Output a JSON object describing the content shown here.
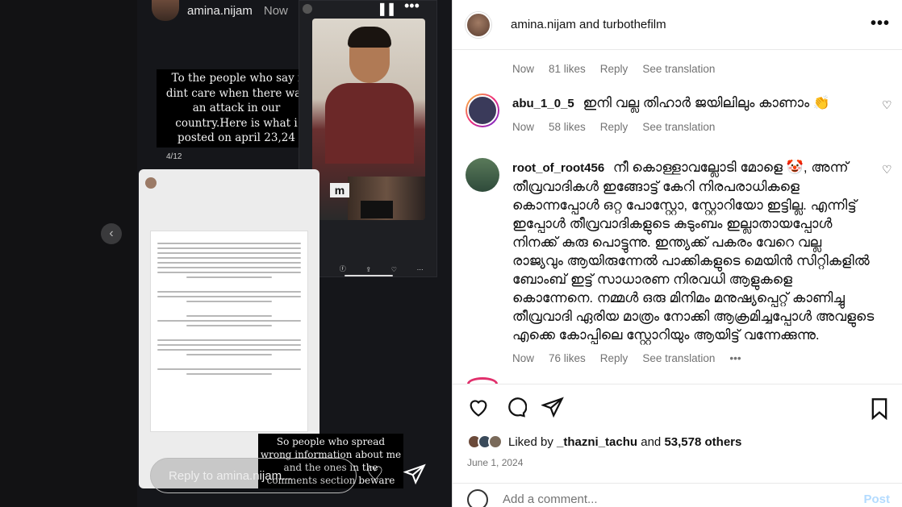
{
  "story": {
    "username": "amina.nijam",
    "time": "Now",
    "overlay_text_1": "To the people who say i dint care when there was an attack in our country.Here is what i posted on april 23,24",
    "count": "4/12",
    "overlay_text_2": "So people who spread wrong information about me and the ones in the comments section beware",
    "reply_placeholder": "Reply to amina.nijam..."
  },
  "post": {
    "header_title": "amina.nijam and turbothefilm",
    "top_meta": {
      "time": "Now",
      "likes": "81 likes",
      "reply": "Reply",
      "translation": "See translation"
    },
    "comments": [
      {
        "user": "abu_1_0_5",
        "text": "ഇനി വല്ല തിഹാർ ജയിലിലും കാണാം 👏",
        "time": "Now",
        "likes": "58 likes",
        "reply": "Reply",
        "translation": "See translation"
      },
      {
        "user": "root_of_root456",
        "text": "നീ കൊള്ളാവല്ലോടി മോളെ 🤡, അന്ന് തീവ്രവാദികൾ ഇങ്ങോട്ട് കേറി നിരപരാധികളെ കൊന്നപ്പോൾ ഒറ്റ പോസ്റ്റോ, സ്റ്റോറിയോ ഇട്ടില്ല. എന്നിട്ട് ഇപ്പോൾ തീവ്രവാദികളുടെ കുടുംബം ഇല്ലാതായപ്പോൾ നിനക്ക് കുരു പൊട്ടുന്നു. ഇന്ത്യക്ക് പകരം വേറെ വല്ല രാജ്യവും ആയിരുന്നേൽ പാക്കികളുടെ മെയിൻ സിറ്റികളിൽ ബോംബ് ഇട്ട് സാധാരണ നിരവധി ആളുകളെ കൊന്നേനെ. നമ്മൾ ഒരു മിനിമം മനുഷ്യപ്പെറ്റ് കാണിച്ചു തീവ്രവാദി ഏരിയ മാത്രം നോക്കി ആക്രമിച്ചപ്പോൾ അവളുടെ എക്കെ കോപ്പിലെ സ്റ്റോറിയും ആയിട്ട് വന്നേക്കുന്നു.",
        "time": "Now",
        "likes": "76 likes",
        "reply": "Reply",
        "translation": "See translation",
        "more": "•••"
      }
    ],
    "liked_by": {
      "prefix": "Liked by",
      "user": "_thazni_tachu",
      "middle": "and",
      "others": "53,578 others"
    },
    "date": "June 1, 2024",
    "add_comment_placeholder": "Add a comment...",
    "post_button": "Post"
  },
  "colors": {
    "accent": "#0095f6",
    "ring": "#e1306c",
    "muted": "#737373"
  }
}
